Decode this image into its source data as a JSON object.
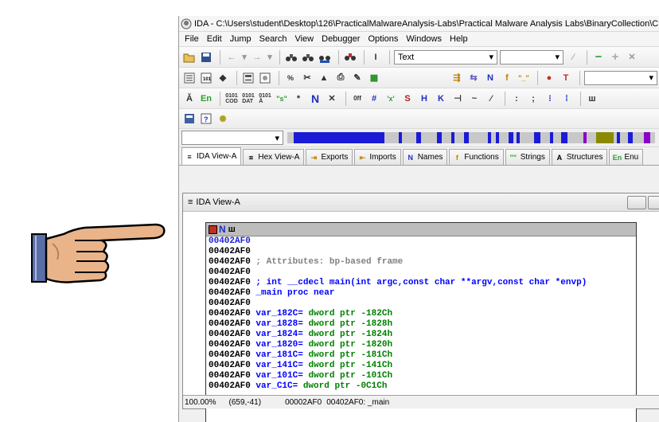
{
  "window": {
    "title": "IDA - C:\\Users\\student\\Desktop\\126\\PracticalMalwareAnalysis-Labs\\Practical Malware Analysis Labs\\BinaryCollection\\C"
  },
  "menu": [
    "File",
    "Edit",
    "Jump",
    "Search",
    "View",
    "Debugger",
    "Options",
    "Windows",
    "Help"
  ],
  "toolbar": {
    "mode_combo": "Text"
  },
  "tabs": [
    {
      "icon": "≡",
      "label": "IDA View-A"
    },
    {
      "icon": "⌗",
      "label": "Hex View-A"
    },
    {
      "icon": "⇥",
      "label": "Exports"
    },
    {
      "icon": "⇤",
      "label": "Imports"
    },
    {
      "icon": "N",
      "label": "Names"
    },
    {
      "icon": "f",
      "label": "Functions"
    },
    {
      "icon": "\"\"",
      "label": "Strings"
    },
    {
      "icon": "A",
      "label": "Structures"
    },
    {
      "icon": "En",
      "label": "Enu"
    }
  ],
  "ida_view": {
    "title": "IDA View-A",
    "lines": [
      {
        "addr": "00402AF0",
        "text": "",
        "kind": "plain",
        "sel": true
      },
      {
        "addr": "00402AF0",
        "text": "",
        "kind": "plain"
      },
      {
        "addr": "00402AF0",
        "text": "; Attributes: bp-based frame",
        "kind": "cmt"
      },
      {
        "addr": "00402AF0",
        "text": "",
        "kind": "plain"
      },
      {
        "addr": "00402AF0",
        "text": "; int __cdecl main(int argc,const char **argv,const char *envp)",
        "kind": "proto"
      },
      {
        "addr": "00402AF0",
        "text": "_main proc near",
        "kind": "lbl"
      },
      {
        "addr": "00402AF0",
        "text": "",
        "kind": "plain"
      },
      {
        "addr": "00402AF0",
        "name": "var_182C=",
        "rest": " dword ptr -182Ch",
        "kind": "var"
      },
      {
        "addr": "00402AF0",
        "name": "var_1828=",
        "rest": " dword ptr -1828h",
        "kind": "var"
      },
      {
        "addr": "00402AF0",
        "name": "var_1824=",
        "rest": " dword ptr -1824h",
        "kind": "var"
      },
      {
        "addr": "00402AF0",
        "name": "var_1820=",
        "rest": " dword ptr -1820h",
        "kind": "var"
      },
      {
        "addr": "00402AF0",
        "name": "var_181C=",
        "rest": " dword ptr -181Ch",
        "kind": "var"
      },
      {
        "addr": "00402AF0",
        "name": "var_141C=",
        "rest": " dword ptr -141Ch",
        "kind": "var"
      },
      {
        "addr": "00402AF0",
        "name": "var_101C=",
        "rest": " dword ptr -101Ch",
        "kind": "var"
      },
      {
        "addr": "00402AF0",
        "name": "var_C1C=",
        "rest": " dword ptr -0C1Ch",
        "kind": "var"
      }
    ]
  },
  "status": {
    "zoom": "100.00%",
    "coords": "(659,-41)",
    "offset": "00002AF0",
    "location": "00402AF0: _main"
  },
  "colors": {
    "nav_blue": "#1b1bd6",
    "nav_gray": "#c8c8c8",
    "nav_purple": "#8a00c8",
    "nav_olive": "#8a8a00"
  }
}
